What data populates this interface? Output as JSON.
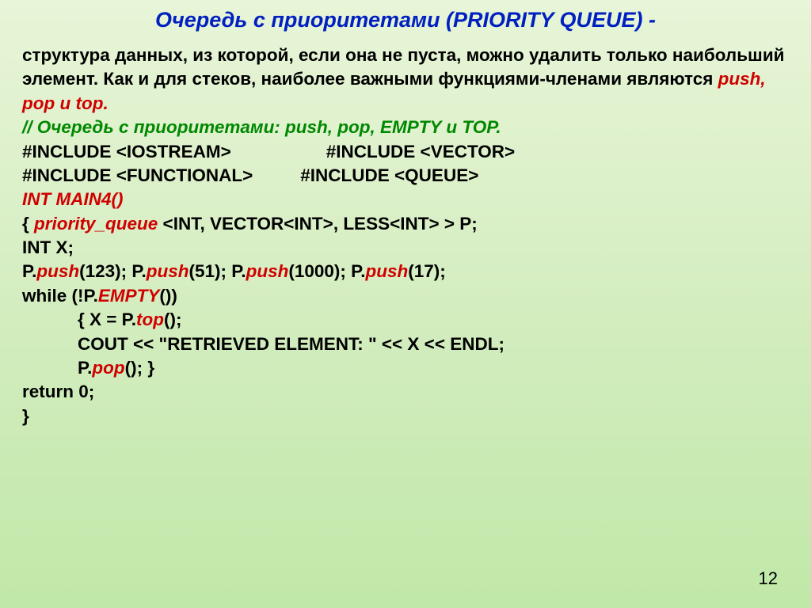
{
  "title": "Очередь с приоритетами (PRIORITY QUEUE) -",
  "intro_part1": "структура данных, из которой, если она не пуста, можно удалить только наибольший элемент. Как и для стеков, наиболее важными функциями-членами являются ",
  "intro_emph": "push, pop и top.",
  "comment_slashes": "// ",
  "comment_text": "Очередь с приоритетами: push,  pop,   EMPTY и TOP.",
  "inc1": "#INCLUDE <IOSTREAM>",
  "inc2": "#INCLUDE <VECTOR>",
  "inc3": "#INCLUDE <FUNCTIONAL>",
  "inc4": "#INCLUDE <QUEUE>",
  "main_sig": "INT MAIN4()",
  "pq_open": "{ ",
  "pq_name": "priority_queue",
  "pq_template": " <INT, VECTOR<INT>, LESS<INT> > P;",
  "var_decl": "INT X;",
  "push_p1": "P.",
  "push_m": "push",
  "push_a1": "(123); P.",
  "push_a2": "(51); P.",
  "push_a3": "(1000); P.",
  "push_a4": "(17);",
  "while_open": "while (!P.",
  "empty_m": "EMPTY",
  "while_close": "())",
  "block_open": "{ X = P.",
  "top_m": "top",
  "block_open2": "();",
  "cout_line": "COUT << \"RETRIEVED ELEMENT: \" << X << ENDL;",
  "pop_p": "P.",
  "pop_m": "pop",
  "pop_close": "(); }",
  "return_line": "return 0;",
  "close_brace": "}",
  "page_number": "12"
}
